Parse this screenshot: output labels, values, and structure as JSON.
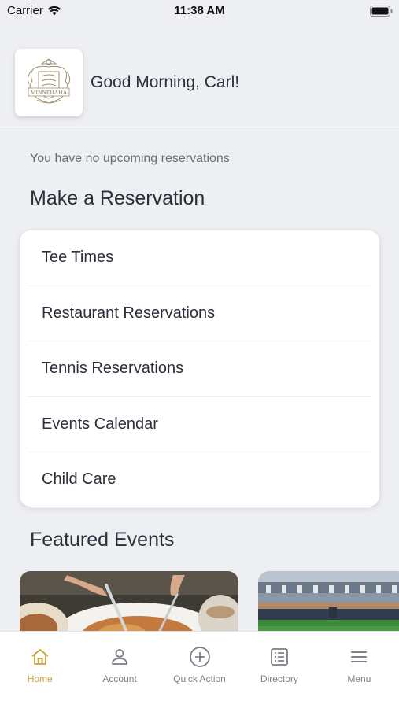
{
  "status_bar": {
    "carrier": "Carrier",
    "time": "11:38 AM"
  },
  "header": {
    "greeting": "Good Morning, Carl!",
    "logo_text": "MINNEHAHA"
  },
  "reservations": {
    "empty_message": "You have no upcoming reservations"
  },
  "make_reservation": {
    "title": "Make a Reservation",
    "items": [
      {
        "label": "Tee Times"
      },
      {
        "label": "Restaurant Reservations"
      },
      {
        "label": "Tennis Reservations"
      },
      {
        "label": "Events Calendar"
      },
      {
        "label": "Child Care"
      }
    ]
  },
  "featured_events": {
    "title": "Featured Events"
  },
  "tab_bar": {
    "active_color": "#c9a23f",
    "items": [
      {
        "label": "Home",
        "icon": "home-icon"
      },
      {
        "label": "Account",
        "icon": "person-icon"
      },
      {
        "label": "Quick Action",
        "icon": "plus-circle-icon"
      },
      {
        "label": "Directory",
        "icon": "list-icon"
      },
      {
        "label": "Menu",
        "icon": "hamburger-icon"
      }
    ]
  }
}
